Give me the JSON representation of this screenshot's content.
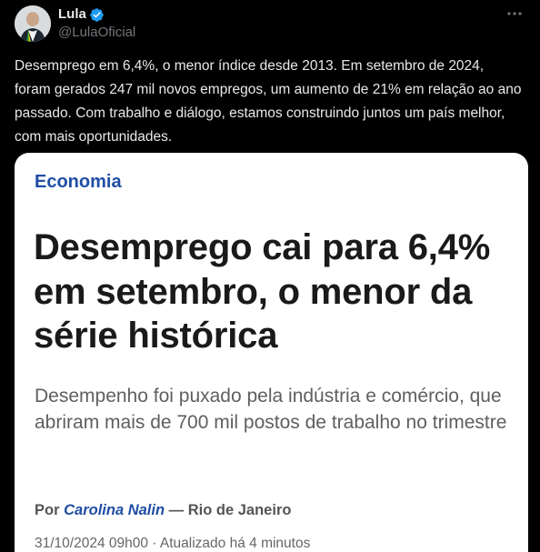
{
  "author": {
    "display_name": "Lula",
    "handle": "@LulaOficial",
    "verified": true
  },
  "tweet": {
    "text": "Desemprego em 6,4%, o menor índice desde 2013. Em setembro de 2024, foram gerados 247 mil novos empregos, um aumento de 21% em relação ao ano passado. Com trabalho e diálogo, estamos construindo juntos um país melhor, com mais oportunidades."
  },
  "card": {
    "section": "Economia",
    "headline": "Desemprego cai para 6,4% em setembro, o menor da série histórica",
    "subtitle": "Desempenho foi puxado pela indústria e comércio, que abriram mais de 700 mil postos de trabalho no trimestre",
    "byline": {
      "prefix": "Por",
      "author": "Carolina Nalin",
      "separator": "—",
      "location": "Rio de Janeiro"
    },
    "timestamp": "31/10/2024 09h00 · Atualizado há 4 minutos"
  },
  "icons": {
    "verified": "verified-badge-icon",
    "more": "more-options-icon"
  },
  "colors": {
    "background": "#000000",
    "text_primary": "#e7e9ea",
    "text_secondary": "#71767b",
    "verified_blue": "#1d9bf0",
    "card_section_blue": "#1f4ea3"
  }
}
